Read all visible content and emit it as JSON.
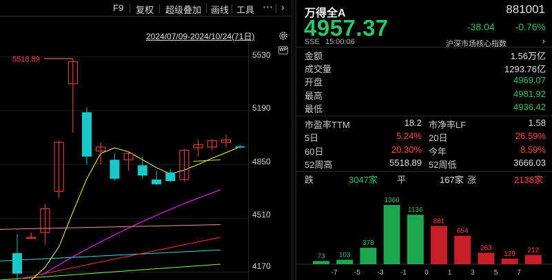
{
  "toolbar": {
    "f9": "F9",
    "restore_rights": "复权",
    "super_overlay": "超级叠加",
    "draw_line": "画线",
    "tools": "工具",
    "more_icon": "ellipsis-icon",
    "arrow_icon": "chevron-right-icon"
  },
  "range_label": "2024/07/09-2024/10/24(71日)",
  "wp_label": "WP",
  "price_axis": {
    "ticks": [
      "5530",
      "5190",
      "4850",
      "4510",
      "4170"
    ]
  },
  "high_marker": "5518.89",
  "colors": {
    "up": "#ff4a4a",
    "down": "#19c8c8",
    "down_text": "#2fc26a",
    "ma5": "#ffffff",
    "ma10": "#ffff55",
    "ma20": "#ff2bff",
    "ma60": "#ff3030",
    "ma120": "#30e0e0",
    "ma250": "#80ff50"
  },
  "chart_data": {
    "type": "candlestick",
    "ylim": [
      4120,
      5620
    ],
    "ticks": [
      5530,
      5190,
      4850,
      4510,
      4170
    ],
    "high_label": 5518.89,
    "candles": [
      {
        "o": 4290,
        "h": 4410,
        "l": 4100,
        "c": 4160
      },
      {
        "o": 4390,
        "h": 4420,
        "l": 4380,
        "c": 4390
      },
      {
        "o": 4420,
        "h": 4600,
        "l": 4340,
        "c": 4570
      },
      {
        "o": 4680,
        "h": 5000,
        "l": 4640,
        "c": 4990
      },
      {
        "o": 5360,
        "h": 5519,
        "l": 5050,
        "c": 5500
      },
      {
        "o": 5180,
        "h": 5210,
        "l": 4850,
        "c": 4900
      },
      {
        "o": 4935,
        "h": 4990,
        "l": 4850,
        "c": 4960
      },
      {
        "o": 4880,
        "h": 4920,
        "l": 4750,
        "c": 4760
      },
      {
        "o": 4880,
        "h": 4930,
        "l": 4810,
        "c": 4920
      },
      {
        "o": 4845,
        "h": 4900,
        "l": 4760,
        "c": 4780
      },
      {
        "o": 4755,
        "h": 4810,
        "l": 4720,
        "c": 4725
      },
      {
        "o": 4800,
        "h": 4820,
        "l": 4740,
        "c": 4745
      },
      {
        "o": 4755,
        "h": 4950,
        "l": 4740,
        "c": 4940
      },
      {
        "o": 4955,
        "h": 5010,
        "l": 4900,
        "c": 4975
      },
      {
        "o": 4960,
        "h": 5010,
        "l": 4940,
        "c": 5000
      },
      {
        "o": 4990,
        "h": 5040,
        "l": 4960,
        "c": 5005
      },
      {
        "o": 4965,
        "h": 4975,
        "l": 4950,
        "c": 4957
      }
    ],
    "ma10": [
      4060,
      4120,
      4200,
      4330,
      4550,
      4760,
      4920,
      4955,
      4930,
      4880,
      4830,
      4790,
      4815,
      4850,
      4890,
      4925,
      4962
    ],
    "ma20_from": [
      4380,
      4690
    ],
    "ma60_from": [
      4130,
      4390
    ],
    "ma120_from": [
      4240,
      4310
    ],
    "ma250_from": [
      4120,
      4220
    ],
    "ma_flat": [
      4440,
      4470
    ],
    "ma_mid": [
      4870,
      4880
    ]
  },
  "quote": {
    "name": "万得全A",
    "code": "881001",
    "price": "4957.37",
    "change": "-38.04",
    "change_pct": "-0.76%",
    "exchange": "SSE",
    "time": "15:00:06",
    "index_tag": "沪深市场核心指数",
    "more_icon": "chevron-right-icon"
  },
  "stats": [
    {
      "label": "金额",
      "value": "1.56万亿",
      "color": "neutral"
    },
    {
      "label": "成交量",
      "value": "1293.76亿",
      "color": "neutral"
    },
    {
      "label": "开盘",
      "value": "4969.07",
      "color": "green"
    },
    {
      "label": "最高",
      "value": "4981.92",
      "color": "green"
    },
    {
      "label": "最低",
      "value": "4936.42",
      "color": "green"
    }
  ],
  "metrics": [
    {
      "l1": "市盈率TTM",
      "v1": "18.2",
      "c1": "neutral",
      "l2": "市净率LF",
      "v2": "1.58",
      "c2": "neutral"
    },
    {
      "l1": "5日",
      "v1": "5.24%",
      "c1": "red",
      "l2": "20日",
      "v2": "26.59%",
      "c2": "red"
    },
    {
      "l1": "60日",
      "v1": "20.30%",
      "c1": "red",
      "l2": "今年",
      "v2": "8.59%",
      "c2": "red"
    },
    {
      "l1": "52周高",
      "v1": "5518.89",
      "c1": "neutral",
      "l2": "52周低",
      "v2": "3666.03",
      "c2": "neutral"
    }
  ],
  "breadth": {
    "down_label": "跌",
    "down_value": "3047家",
    "flat_label": "平",
    "flat_value": "167家",
    "up_label": "涨",
    "up_value": "2138家"
  },
  "distribution": {
    "type": "bar",
    "categories": [
      "-7",
      "-5",
      "-3",
      "-1",
      "0",
      "1",
      "3",
      "5",
      "7"
    ],
    "bins": [
      {
        "value": 73,
        "side": "down"
      },
      {
        "value": 103,
        "side": "down"
      },
      {
        "value": 378,
        "side": "down"
      },
      {
        "value": 1360,
        "side": "down"
      },
      {
        "value": 1136,
        "side": "down"
      },
      {
        "value": 881,
        "side": "up"
      },
      {
        "value": 654,
        "side": "up"
      },
      {
        "value": 263,
        "side": "up"
      },
      {
        "value": 129,
        "side": "up"
      },
      {
        "value": 212,
        "side": "up"
      }
    ]
  }
}
